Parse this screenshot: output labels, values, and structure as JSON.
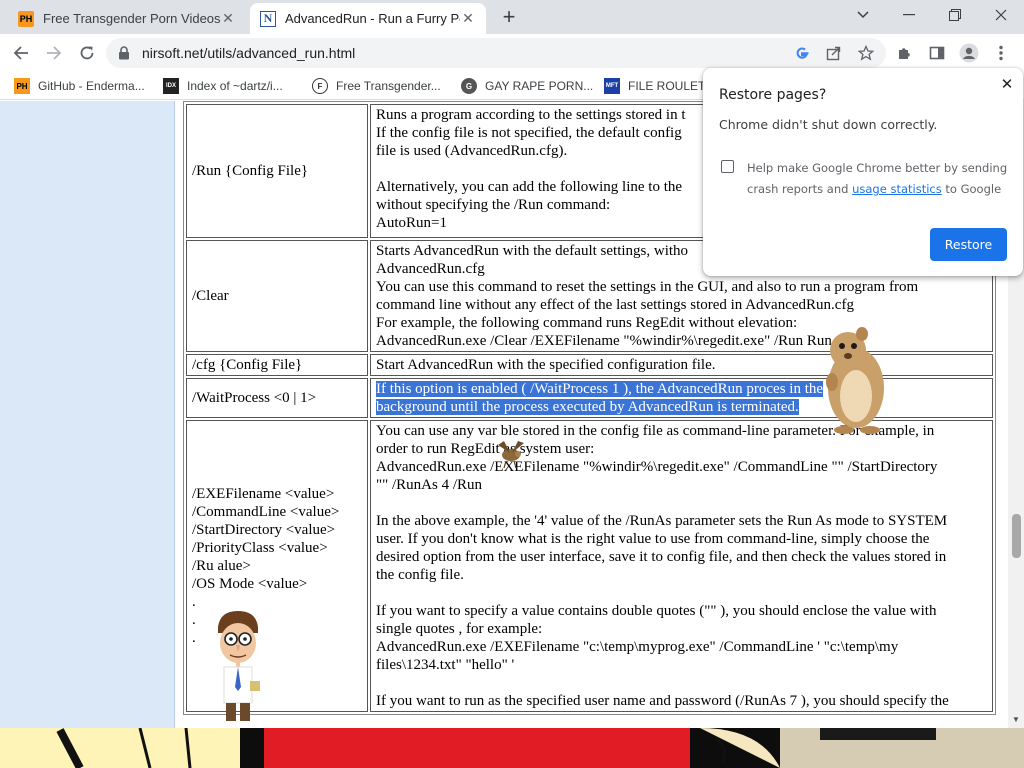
{
  "tabs": [
    {
      "favicon": "PH",
      "title": "Free Transgender Porn Videos"
    },
    {
      "favicon": "N",
      "title": "AdvancedRun - Run a Furry Peg"
    }
  ],
  "address": {
    "url": "nirsoft.net/utils/advanced_run.html"
  },
  "bookmarks": [
    {
      "icon_text": "PH",
      "label": "GitHub - Enderma..."
    },
    {
      "icon_text": "IDX",
      "label": "Index of ~dartz/i..."
    },
    {
      "icon_text": "F",
      "label": "Free Transgender..."
    },
    {
      "icon_text": "G",
      "label": "GAY RAPE PORN..."
    },
    {
      "icon_text": "MFT",
      "label": "FILE ROULET"
    }
  ],
  "popup": {
    "title": "Restore pages?",
    "message": "Chrome didn't shut down correctly.",
    "checkbox_pre": "Help make Google Chrome better by sending crash reports and ",
    "checkbox_link": "usage statistics",
    "checkbox_post": " to Google",
    "restore_label": "Restore"
  },
  "rows": [
    {
      "cmd": "/Run {Config File}",
      "desc": [
        "Runs a program according to the settings stored in t",
        "If the config file is not specified, the default config",
        "file is used (AdvancedRun.cfg).",
        "",
        "Alternatively, you can add the following line to the",
        "without specifying the /Run command:",
        "AutoRun=1"
      ]
    },
    {
      "cmd": "/Clear",
      "desc": [
        "Starts AdvancedRun with the default settings, witho",
        "AdvancedRun.cfg",
        "You can use this command to reset the settings in the GUI, and also to run a program from",
        "command line without any effect of the last settings stored in AdvancedRun.cfg",
        "For example, the following command runs RegEdit without elevation:",
        "AdvancedRun.exe /Clear /EXEFilename \"%windir%\\regedit.exe\" /Run     Run"
      ]
    },
    {
      "cmd": "/cfg {Config File}",
      "desc": [
        "Start AdvancedRun with the specified configuration file."
      ]
    },
    {
      "cmd": "/WaitProcess <0 | 1>",
      "desc_highlight": [
        "If this option is enabled ( /WaitProcess 1 ), the AdvancedRun proces             in the",
        "background until the process executed by AdvancedRun is terminated."
      ]
    },
    {
      "cmd_lines": [
        "/EXEFilename <value>",
        "/CommandLine <value>",
        "/StartDirectory <value>",
        "/PriorityClass <value>",
        "/Ru        alue>",
        "/OS        Mode <value>",
        ".",
        ".",
        "."
      ],
      "desc": [
        "You can use any var   ble stored in the config file as command-line parameter. For example, in",
        "order to run RegEdit as system user:",
        "AdvancedRun.exe /EXEFilename \"%windir%\\regedit.exe\" /CommandLine \"\" /StartDirectory",
        "\"\" /RunAs 4 /Run",
        "",
        "In the above example, the '4' value of the /RunAs parameter sets the Run As mode to SYSTEM",
        "user. If you don't know what is the right value to use from command-line, simply choose the",
        "desired option from the user interface, save it to config file, and then check the values stored in",
        "the config file.",
        "",
        "If you want to specify a value contains double quotes (\"\" ), you should enclose the value with",
        "single quotes , for example:",
        "AdvancedRun.exe /EXEFilename \"c:\\temp\\myprog.exe\" /CommandLine ' \"c:\\temp\\my",
        "files\\1234.txt\" \"hello\" '",
        "",
        "If you want to run as the specified user name and password (/RunAs 7 ), you should specify the"
      ]
    }
  ]
}
